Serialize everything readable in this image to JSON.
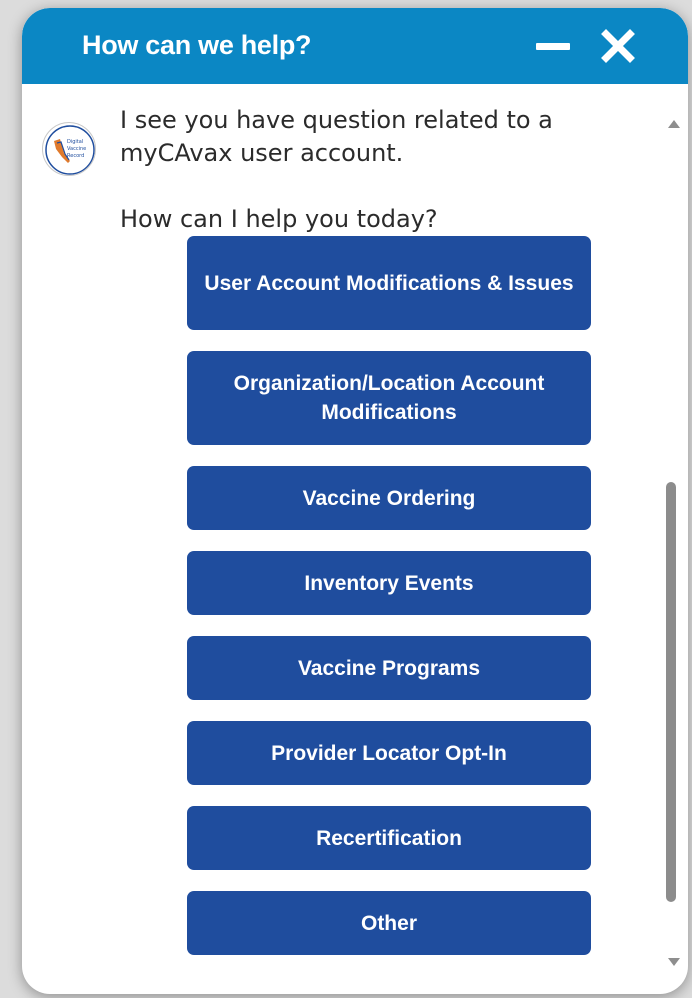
{
  "header": {
    "title": "How can we help?",
    "minimize_icon": "minus-icon",
    "close_icon": "close-icon",
    "background_color": "#0b87c4"
  },
  "message": {
    "avatar_icon": "digital-vaccine-record-logo",
    "avatar_text": "Digital Vaccine Record",
    "line1": "I see you have question related to a",
    "line2": "myCAvax user account.",
    "line3": "How can I help you today?"
  },
  "options": [
    {
      "label": "User Account Modifications & Issues"
    },
    {
      "label": "Organization/Location Account Modifications"
    },
    {
      "label": "Vaccine Ordering"
    },
    {
      "label": "Inventory Events"
    },
    {
      "label": "Vaccine Programs"
    },
    {
      "label": "Provider Locator Opt-In"
    },
    {
      "label": "Recertification"
    },
    {
      "label": "Other"
    }
  ],
  "colors": {
    "button_bg": "#1f4d9e",
    "button_text": "#ffffff",
    "message_text": "#2b2b2b"
  }
}
